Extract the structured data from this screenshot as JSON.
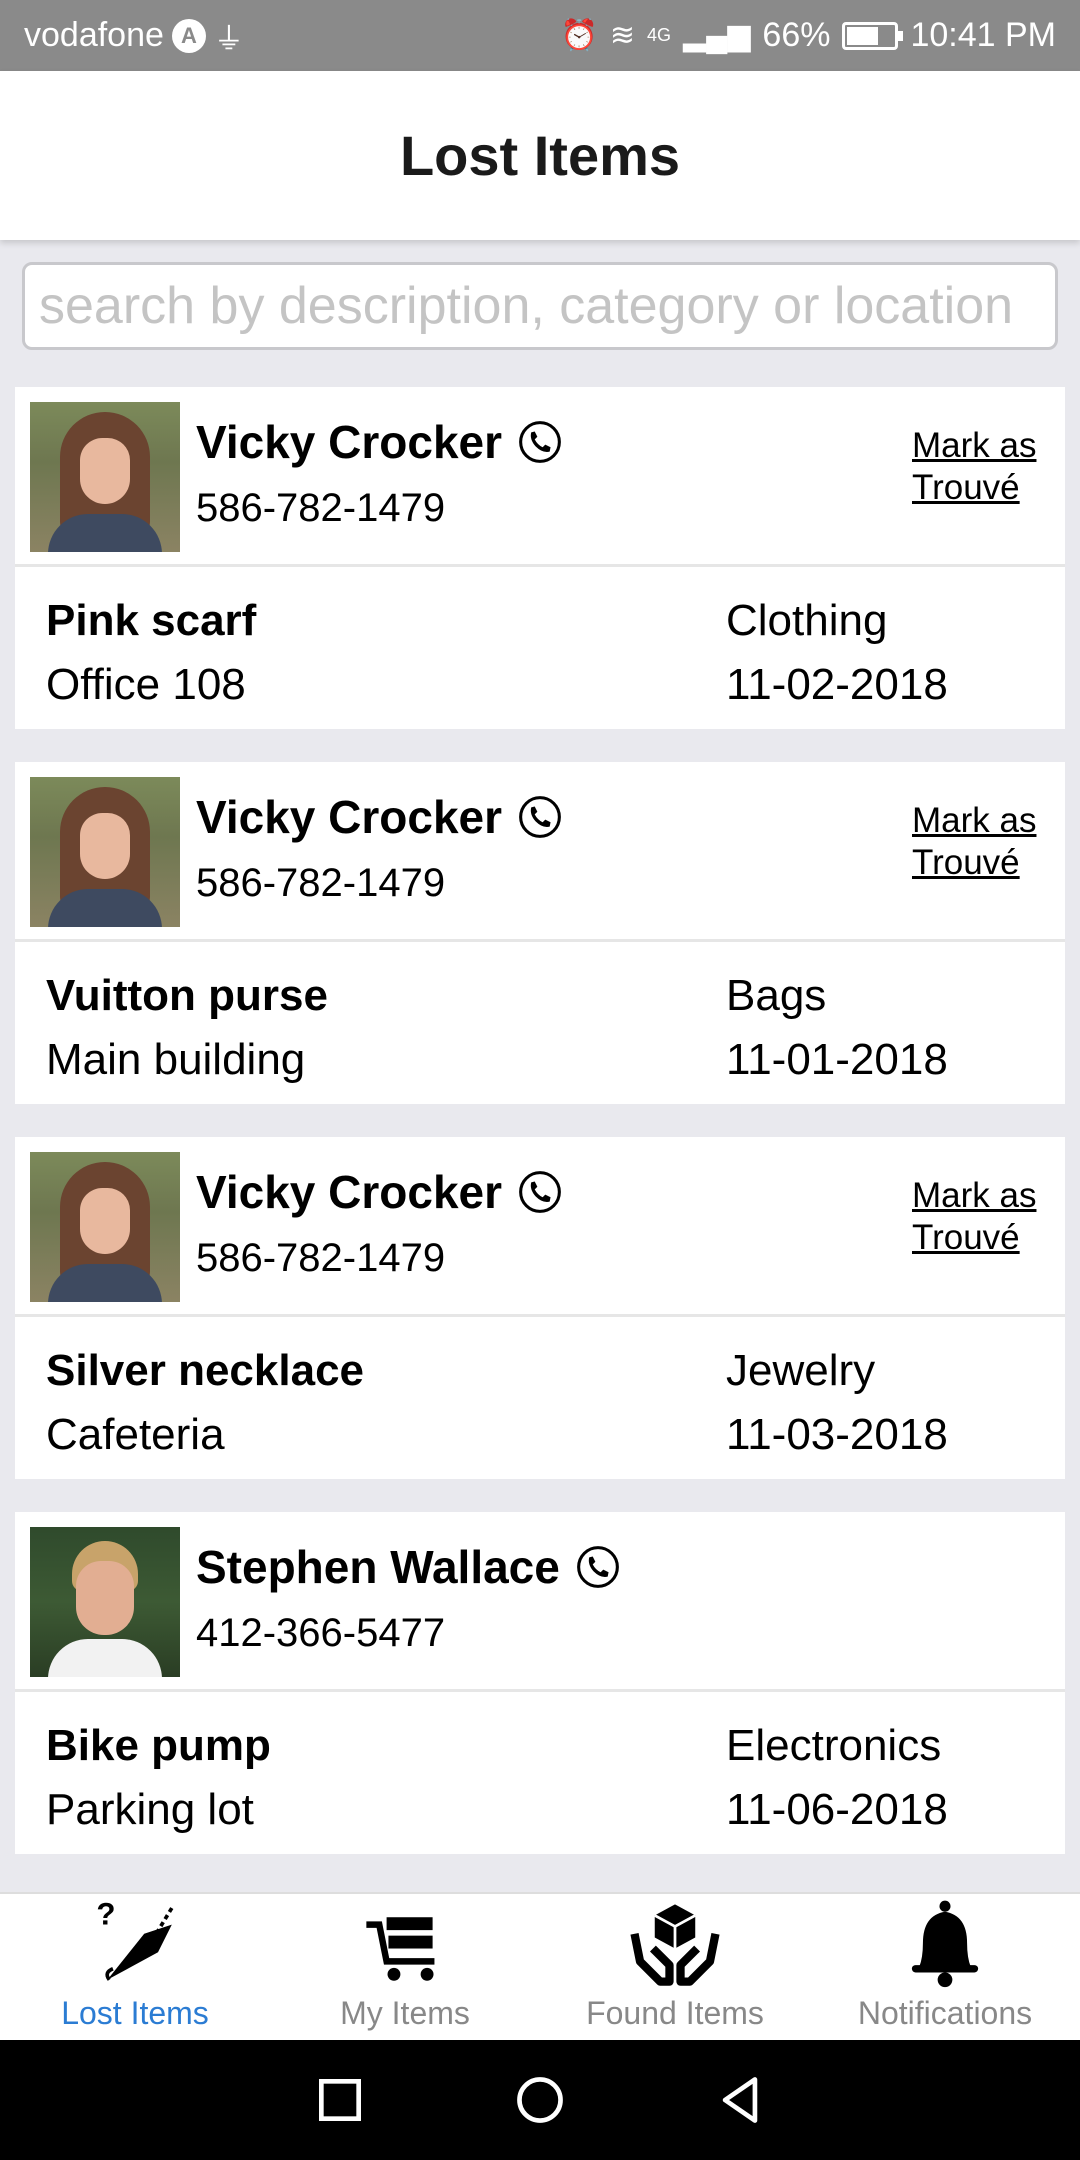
{
  "status_bar": {
    "carrier": "vodafone",
    "network": "4G",
    "battery": "66%",
    "battery_level": 0.66,
    "time": "10:41 PM"
  },
  "header": {
    "title": "Lost Items"
  },
  "search": {
    "placeholder": "search by description, category or location",
    "value": ""
  },
  "items": [
    {
      "name": "Vicky Crocker",
      "phone": "586-782-1479",
      "action": "Mark as Trouvé",
      "title": "Pink scarf",
      "location": "Office 108",
      "category": "Clothing",
      "date": "11-02-2018",
      "avatar": "female"
    },
    {
      "name": "Vicky Crocker",
      "phone": "586-782-1479",
      "action": "Mark as Trouvé",
      "title": "Vuitton purse",
      "location": "Main building",
      "category": "Bags",
      "date": "11-01-2018",
      "avatar": "female"
    },
    {
      "name": "Vicky Crocker",
      "phone": "586-782-1479",
      "action": "Mark as Trouvé",
      "title": "Silver necklace",
      "location": "Cafeteria",
      "category": "Jewelry",
      "date": "11-03-2018",
      "avatar": "female"
    },
    {
      "name": "Stephen Wallace",
      "phone": "412-366-5477",
      "action": "",
      "title": "Bike pump",
      "location": "Parking lot",
      "category": "Electronics",
      "date": "11-06-2018",
      "avatar": "male"
    }
  ],
  "tabs": [
    {
      "label": "Lost Items",
      "icon": "lost-items-icon",
      "active": true
    },
    {
      "label": "My Items",
      "icon": "cart-icon",
      "active": false
    },
    {
      "label": "Found Items",
      "icon": "hands-box-icon",
      "active": false
    },
    {
      "label": "Notifications",
      "icon": "bell-icon",
      "active": false
    }
  ],
  "colors": {
    "active_tab": "#2b7cd3",
    "inactive_tab": "#888888",
    "status_bar": "#8a8a8a"
  }
}
